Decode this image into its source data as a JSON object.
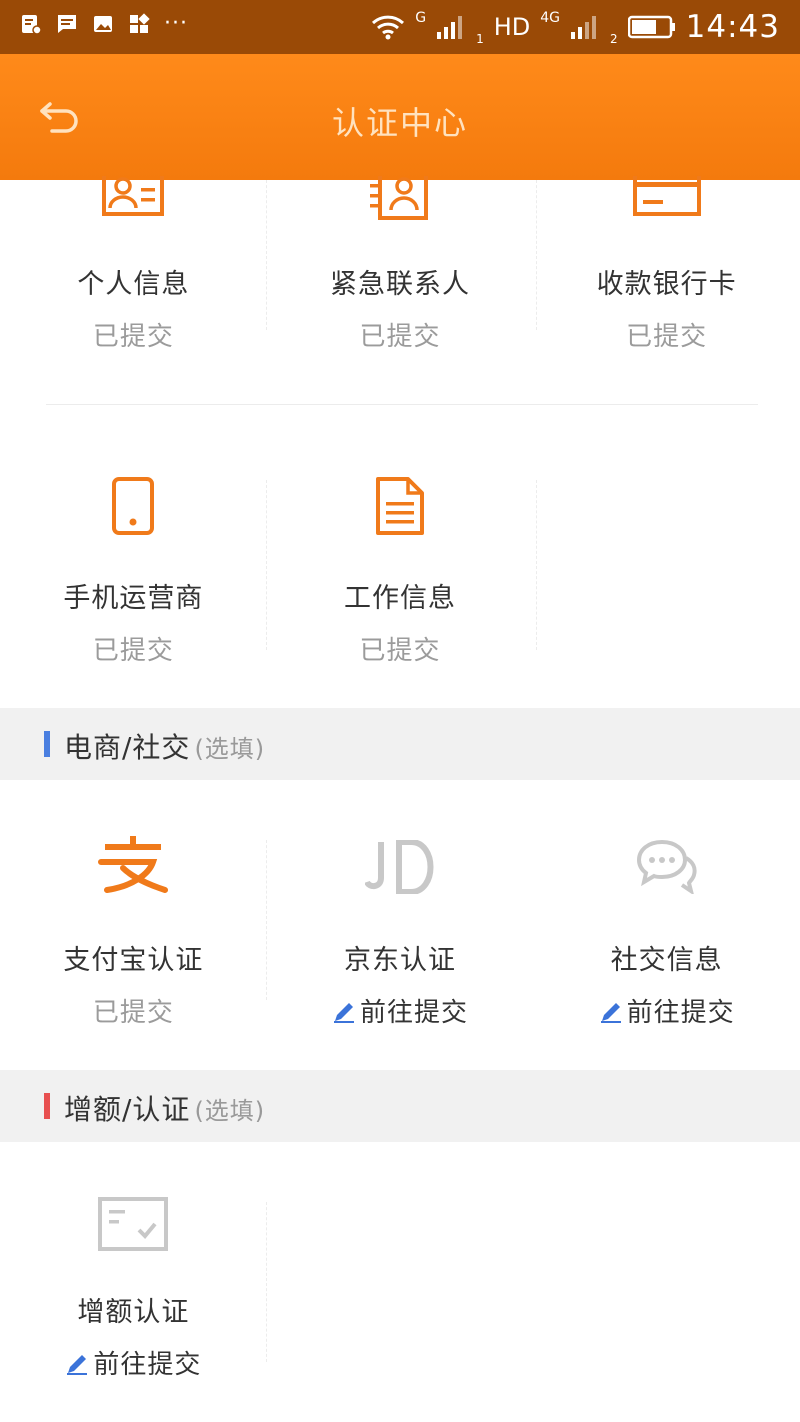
{
  "status_bar": {
    "network_label": "G",
    "hd_label": "HD",
    "net2_label": "4G",
    "sim1": "1",
    "sim2": "2",
    "time": "14:43",
    "more": "···",
    "icons": [
      "notification-doc-icon",
      "message-icon",
      "image-icon",
      "apps-icon",
      "wifi-icon",
      "signal-icon",
      "battery-icon"
    ]
  },
  "header": {
    "title": "认证中心",
    "back_icon": "back-arrow-icon",
    "color": "#f7830f"
  },
  "required_items": [
    {
      "label": "个人信息",
      "status": "已提交",
      "icon": "id-card-icon"
    },
    {
      "label": "紧急联系人",
      "status": "已提交",
      "icon": "contact-list-icon"
    },
    {
      "label": "收款银行卡",
      "status": "已提交",
      "icon": "bank-card-icon"
    },
    {
      "label": "手机运营商",
      "status": "已提交",
      "icon": "mobile-phone-icon"
    },
    {
      "label": "工作信息",
      "status": "已提交",
      "icon": "document-icon"
    }
  ],
  "sections": [
    {
      "title": "电商/社交",
      "optional": "(选填)",
      "accent": "#4a7fe0",
      "items": [
        {
          "label": "支付宝认证",
          "status": "已提交",
          "icon": "alipay-icon"
        },
        {
          "label": "京东认证",
          "status": "前往提交",
          "icon": "jd-icon"
        },
        {
          "label": "社交信息",
          "status": "前往提交",
          "icon": "chat-bubbles-icon"
        }
      ]
    },
    {
      "title": "增额/认证",
      "optional": "(选填)",
      "accent": "#e85050",
      "items": [
        {
          "label": "增额认证",
          "status": "前往提交",
          "icon": "increase-credit-icon"
        }
      ]
    }
  ],
  "colors": {
    "accent_orange": "#f07a1a",
    "muted_gray": "#c8c8c8",
    "pencil_blue": "#3b73d9"
  }
}
